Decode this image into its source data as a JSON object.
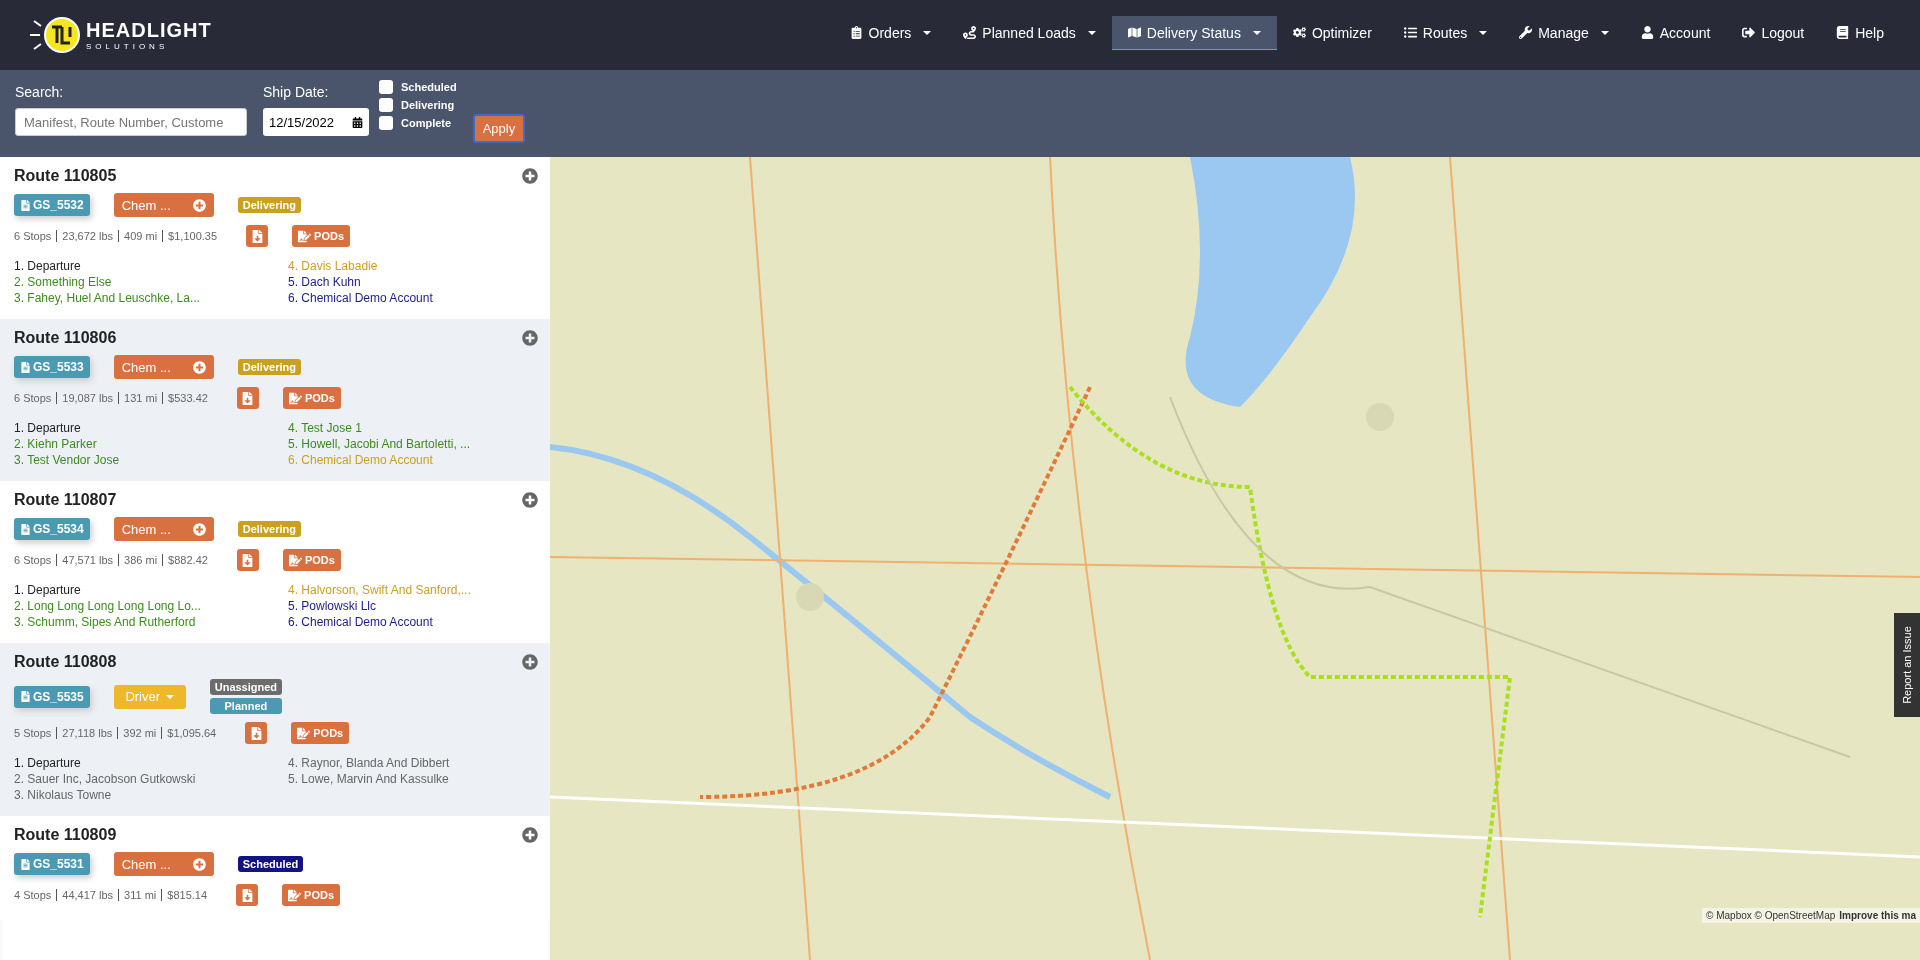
{
  "brand": {
    "name": "HEADLIGHT",
    "tagline": "SOLUTIONS"
  },
  "nav": [
    {
      "label": "Orders",
      "dropdown": true,
      "selected": false
    },
    {
      "label": "Planned Loads",
      "dropdown": true,
      "selected": false
    },
    {
      "label": "Delivery Status",
      "dropdown": true,
      "selected": true
    },
    {
      "label": "Optimizer",
      "dropdown": false,
      "selected": false
    },
    {
      "label": "Routes",
      "dropdown": true,
      "selected": false
    },
    {
      "label": "Manage",
      "dropdown": true,
      "selected": false
    },
    {
      "label": "Account",
      "dropdown": false,
      "selected": false
    },
    {
      "label": "Logout",
      "dropdown": false,
      "selected": false
    },
    {
      "label": "Help",
      "dropdown": false,
      "selected": false
    }
  ],
  "filters": {
    "search_label": "Search:",
    "search_placeholder": "Manifest, Route Number, Custome",
    "date_label": "Ship Date:",
    "date_value": "12/15/2022",
    "statuses": [
      {
        "label": "Scheduled",
        "checked": false
      },
      {
        "label": "Delivering",
        "checked": false
      },
      {
        "label": "Complete",
        "checked": false
      }
    ],
    "apply": "Apply"
  },
  "routes": [
    {
      "title": "Route 110805",
      "manifest": "GS_5532",
      "assign": {
        "kind": "chem",
        "label": "Chem ..."
      },
      "badges": [
        {
          "kind": "delivering",
          "label": "Delivering"
        }
      ],
      "stats": [
        "6 Stops",
        "23,672 lbs",
        "409 mi",
        "$1,100.35"
      ],
      "pods": "PODs",
      "stops": [
        {
          "label": "1. Departure",
          "color": "#222222"
        },
        {
          "label": "2. Something Else",
          "color": "#3d8b1e"
        },
        {
          "label": "3. Fahey, Huel And Leuschke, La...",
          "color": "#3d8b1e"
        },
        {
          "label": "4. Davis Labadie",
          "color": "#c9a01f"
        },
        {
          "label": "5. Dach Kuhn",
          "color": "#1c1c8a"
        },
        {
          "label": "6. Chemical Demo Account",
          "color": "#1c1c8a"
        }
      ]
    },
    {
      "title": "Route 110806",
      "manifest": "GS_5533",
      "assign": {
        "kind": "chem",
        "label": "Chem ..."
      },
      "badges": [
        {
          "kind": "delivering",
          "label": "Delivering"
        }
      ],
      "stats": [
        "6 Stops",
        "19,087 lbs",
        "131 mi",
        "$533.42"
      ],
      "pods": "PODs",
      "stops": [
        {
          "label": "1. Departure",
          "color": "#222222"
        },
        {
          "label": "2. Kiehn Parker",
          "color": "#3d8b1e"
        },
        {
          "label": "3. Test Vendor Jose",
          "color": "#3d8b1e"
        },
        {
          "label": "4. Test Jose 1",
          "color": "#3d8b1e"
        },
        {
          "label": "5. Howell, Jacobi And Bartoletti, ...",
          "color": "#3d8b1e"
        },
        {
          "label": "6. Chemical Demo Account",
          "color": "#c9a01f"
        }
      ]
    },
    {
      "title": "Route 110807",
      "manifest": "GS_5534",
      "assign": {
        "kind": "chem",
        "label": "Chem ..."
      },
      "badges": [
        {
          "kind": "delivering",
          "label": "Delivering"
        }
      ],
      "stats": [
        "6 Stops",
        "47,571 lbs",
        "386 mi",
        "$882.42"
      ],
      "pods": "PODs",
      "stops": [
        {
          "label": "1. Departure",
          "color": "#222222"
        },
        {
          "label": "2. Long Long Long Long Long Lo...",
          "color": "#3d8b1e"
        },
        {
          "label": "3. Schumm, Sipes And Rutherford",
          "color": "#3d8b1e"
        },
        {
          "label": "4. Halvorson, Swift And Sanford,...",
          "color": "#c9a01f"
        },
        {
          "label": "5. Powlowski Llc",
          "color": "#1c1c8a"
        },
        {
          "label": "6. Chemical Demo Account",
          "color": "#1c1c8a"
        }
      ]
    },
    {
      "title": "Route 110808",
      "manifest": "GS_5535",
      "assign": {
        "kind": "driver",
        "label": "Driver"
      },
      "badges": [
        {
          "kind": "unassigned",
          "label": "Unassigned"
        },
        {
          "kind": "planned",
          "label": "Planned"
        }
      ],
      "stats": [
        "5 Stops",
        "27,118 lbs",
        "392 mi",
        "$1,095.64"
      ],
      "pods": "PODs",
      "stops": [
        {
          "label": "1. Departure",
          "color": "#222222"
        },
        {
          "label": "2. Sauer Inc, Jacobson Gutkowski",
          "color": "#666666"
        },
        {
          "label": "3. Nikolaus Towne",
          "color": "#666666"
        },
        {
          "label": "4. Raynor, Blanda And Dibbert",
          "color": "#666666"
        },
        {
          "label": "5. Lowe, Marvin And Kassulke",
          "color": "#666666"
        }
      ]
    },
    {
      "title": "Route 110809",
      "manifest": "GS_5531",
      "assign": {
        "kind": "chem",
        "label": "Chem ..."
      },
      "badges": [
        {
          "kind": "scheduled",
          "label": "Scheduled"
        }
      ],
      "stats": [
        "4 Stops",
        "44,417 lbs",
        "311 mi",
        "$815.14"
      ],
      "pods": "PODs"
    }
  ],
  "map": {
    "kind": "picture",
    "report": "Report an Issue",
    "attribution": "© Mapbox © OpenStreetMap",
    "improve": "Improve this ma"
  }
}
